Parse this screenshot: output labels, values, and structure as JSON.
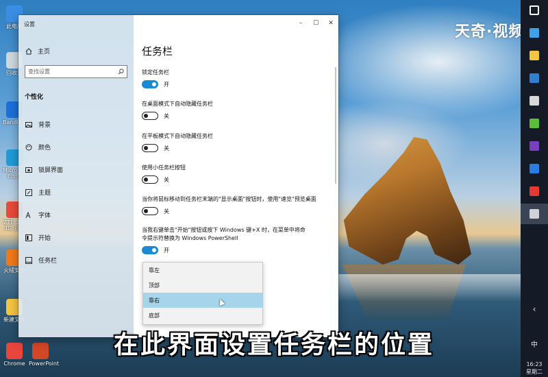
{
  "watermark": "天奇·视频",
  "subtitle": "在此界面设置任务栏的位置",
  "desktop_icons": [
    {
      "label": "此电脑",
      "color": "#3a8ee6"
    },
    {
      "label": "回收站",
      "color": "#cfd8e0"
    },
    {
      "label": "Bandizip",
      "color": "#1e6fd9"
    },
    {
      "label": "Microsoft Edge",
      "color": "#1f9bd8"
    },
    {
      "label": "ZTE 3G-4G 驱动",
      "color": "#e84b3a"
    },
    {
      "label": "火绒安全",
      "color": "#f07a1a"
    },
    {
      "label": "新建文件",
      "color": "#f5c542"
    },
    {
      "label": "Chrome",
      "color": "#e8453c"
    },
    {
      "label": "PowerPoint",
      "color": "#d24726"
    }
  ],
  "window": {
    "title": "设置",
    "minimize": "–",
    "maximize": "☐",
    "close": "✕",
    "home_label": "主页",
    "search_placeholder": "查找设置",
    "section_label": "个性化",
    "nav_items": [
      {
        "label": "背景",
        "icon": "image-icon"
      },
      {
        "label": "颜色",
        "icon": "palette-icon"
      },
      {
        "label": "锁屏界面",
        "icon": "lock-screen-icon"
      },
      {
        "label": "主题",
        "icon": "brush-icon"
      },
      {
        "label": "字体",
        "icon": "font-icon"
      },
      {
        "label": "开始",
        "icon": "start-icon"
      },
      {
        "label": "任务栏",
        "icon": "taskbar-icon"
      }
    ],
    "page_title": "任务栏",
    "settings": [
      {
        "label": "锁定任务栏",
        "state": "开",
        "on": true
      },
      {
        "label": "在桌面模式下自动隐藏任务栏",
        "state": "关",
        "on": false
      },
      {
        "label": "在平板模式下自动隐藏任务栏",
        "state": "关",
        "on": false
      },
      {
        "label": "使用小任务栏按钮",
        "state": "关",
        "on": false
      },
      {
        "label": "当你将鼠标移动到任务栏末端的\"显示桌面\"按钮时，使用\"速览\"预览桌面",
        "state": "关",
        "on": false
      },
      {
        "label": "当我右键单击\"开始\"按钮或按下 Windows 键+X 时，在菜单中将命令提示符替换为 Windows PowerShell",
        "state": "开",
        "on": true
      }
    ],
    "dropdown_options": [
      "靠左",
      "顶部",
      "靠右",
      "底部"
    ],
    "dropdown_selected": "靠右"
  },
  "taskbar": {
    "buttons": [
      {
        "icon": "windows-start-icon",
        "color": "#ffffff"
      },
      {
        "icon": "ie-icon",
        "color": "#3ea0e8"
      },
      {
        "icon": "file-explorer-icon",
        "color": "#f4c542"
      },
      {
        "icon": "store-icon",
        "color": "#2f80d1"
      },
      {
        "icon": "app-icon",
        "color": "#d8d8d8"
      },
      {
        "icon": "upload-icon",
        "color": "#5cbf3a"
      },
      {
        "icon": "premiere-icon",
        "color": "#7a3fbf"
      },
      {
        "icon": "phone-icon",
        "color": "#2a7de1"
      },
      {
        "icon": "wps-icon",
        "color": "#e53935"
      },
      {
        "icon": "settings-gear-icon",
        "color": "#cfd3d8"
      }
    ],
    "tray_chevron": "‹",
    "ime": "中",
    "time": "16:23",
    "weekday": "星期二"
  }
}
